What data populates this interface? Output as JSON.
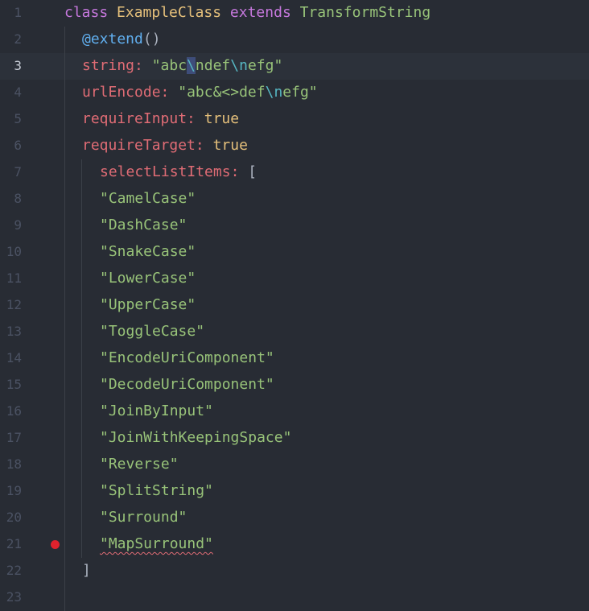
{
  "editor": {
    "active_line": 3,
    "breakpoint_line": 21,
    "colors": {
      "background": "#282c34",
      "keyword": "#c678dd",
      "class_name": "#e5c07b",
      "function": "#61afef",
      "property": "#e06c75",
      "string": "#98c379",
      "escape": "#56b6c2",
      "breakpoint": "#e0222d"
    },
    "lines": [
      {
        "number": "1",
        "indent": 0,
        "tokens": [
          {
            "t": "class",
            "c": "kw"
          },
          {
            "t": " "
          },
          {
            "t": "ExampleClass",
            "c": "cls"
          },
          {
            "t": " "
          },
          {
            "t": "extends",
            "c": "kw"
          },
          {
            "t": " "
          },
          {
            "t": "TransformString",
            "c": "str"
          }
        ]
      },
      {
        "number": "2",
        "indent": 1,
        "tokens": [
          {
            "t": "@extend",
            "c": "fn"
          },
          {
            "t": "()",
            "c": "punc"
          }
        ]
      },
      {
        "number": "3",
        "indent": 1,
        "tokens": [
          {
            "t": "string",
            "c": "prop"
          },
          {
            "t": ": ",
            "c": "prop"
          },
          {
            "t": "\"abc",
            "c": "str"
          },
          {
            "t": "\\",
            "c": "esc",
            "cursor": true
          },
          {
            "t": "ndef",
            "c": "str"
          },
          {
            "t": "\\n",
            "c": "esc"
          },
          {
            "t": "efg\"",
            "c": "str"
          }
        ]
      },
      {
        "number": "4",
        "indent": 1,
        "tokens": [
          {
            "t": "urlEncode",
            "c": "prop"
          },
          {
            "t": ": ",
            "c": "prop"
          },
          {
            "t": "\"abc&<>def",
            "c": "str"
          },
          {
            "t": "\\n",
            "c": "esc"
          },
          {
            "t": "efg\"",
            "c": "str"
          }
        ]
      },
      {
        "number": "5",
        "indent": 1,
        "tokens": [
          {
            "t": "requireInput",
            "c": "prop"
          },
          {
            "t": ": ",
            "c": "prop"
          },
          {
            "t": "true",
            "c": "bool"
          }
        ]
      },
      {
        "number": "6",
        "indent": 1,
        "tokens": [
          {
            "t": "requireTarget",
            "c": "prop"
          },
          {
            "t": ": ",
            "c": "prop"
          },
          {
            "t": "true",
            "c": "bool"
          }
        ]
      },
      {
        "number": "7",
        "indent": 2,
        "tokens": [
          {
            "t": "selectListItems",
            "c": "prop"
          },
          {
            "t": ": ",
            "c": "prop"
          },
          {
            "t": "[",
            "c": "punc"
          }
        ]
      },
      {
        "number": "8",
        "indent": 2,
        "tokens": [
          {
            "t": "\"CamelCase\"",
            "c": "str"
          }
        ]
      },
      {
        "number": "9",
        "indent": 2,
        "tokens": [
          {
            "t": "\"DashCase\"",
            "c": "str"
          }
        ]
      },
      {
        "number": "10",
        "indent": 2,
        "tokens": [
          {
            "t": "\"SnakeCase\"",
            "c": "str"
          }
        ]
      },
      {
        "number": "11",
        "indent": 2,
        "tokens": [
          {
            "t": "\"LowerCase\"",
            "c": "str"
          }
        ]
      },
      {
        "number": "12",
        "indent": 2,
        "tokens": [
          {
            "t": "\"UpperCase\"",
            "c": "str"
          }
        ]
      },
      {
        "number": "13",
        "indent": 2,
        "tokens": [
          {
            "t": "\"ToggleCase\"",
            "c": "str"
          }
        ]
      },
      {
        "number": "14",
        "indent": 2,
        "tokens": [
          {
            "t": "\"EncodeUriComponent\"",
            "c": "str"
          }
        ]
      },
      {
        "number": "15",
        "indent": 2,
        "tokens": [
          {
            "t": "\"DecodeUriComponent\"",
            "c": "str"
          }
        ]
      },
      {
        "number": "16",
        "indent": 2,
        "tokens": [
          {
            "t": "\"JoinByInput\"",
            "c": "str"
          }
        ]
      },
      {
        "number": "17",
        "indent": 2,
        "tokens": [
          {
            "t": "\"JoinWithKeepingSpace\"",
            "c": "str"
          }
        ]
      },
      {
        "number": "18",
        "indent": 2,
        "tokens": [
          {
            "t": "\"Reverse\"",
            "c": "str"
          }
        ]
      },
      {
        "number": "19",
        "indent": 2,
        "tokens": [
          {
            "t": "\"SplitString\"",
            "c": "str"
          }
        ]
      },
      {
        "number": "20",
        "indent": 2,
        "tokens": [
          {
            "t": "\"Surround\"",
            "c": "str"
          }
        ]
      },
      {
        "number": "21",
        "indent": 2,
        "tokens": [
          {
            "t": "\"MapSurround\"",
            "c": "str",
            "squiggle": true
          }
        ]
      },
      {
        "number": "22",
        "indent": 1,
        "tokens": [
          {
            "t": "]",
            "c": "punc"
          }
        ]
      },
      {
        "number": "23",
        "indent": 1,
        "tokens": []
      }
    ]
  }
}
